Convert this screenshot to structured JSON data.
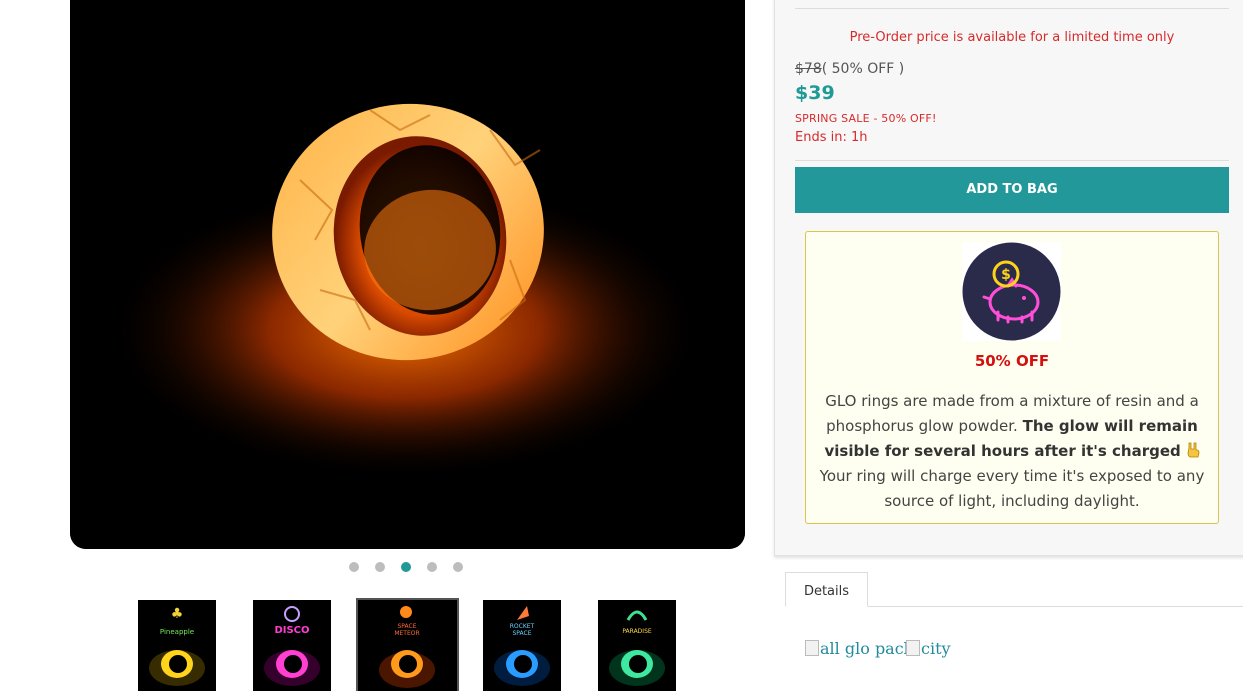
{
  "product": {
    "preorder_note": "Pre-Order price is available for a limited time only",
    "old_price": "$78",
    "discount_pct": "( 50% OFF )",
    "price": "$39",
    "sale_label": "SPRING SALE - 50% OFF!",
    "ends_in": "Ends in: 1h",
    "add_to_bag": "ADD TO BAG"
  },
  "promo": {
    "icon": "piggy-bank-icon",
    "badge": "50% OFF",
    "text_intro": "GLO rings are made from a mixture of resin and a phosphorus glow powder.",
    "text_bold": "The glow will remain visible for several hours after it's charged",
    "text_outro": "Your ring will charge every time it's exposed to any source of light, including daylight."
  },
  "gallery": {
    "active_slide": 3,
    "slide_count": 5,
    "thumbnails": [
      {
        "name": "pineapple",
        "color": "#f2d23a"
      },
      {
        "name": "disco-ball",
        "color": "#e040c8"
      },
      {
        "name": "space-meteor",
        "color": "#ff8a1a"
      },
      {
        "name": "rocket-space",
        "color": "#2a8cff"
      },
      {
        "name": "paradise",
        "color": "#2fe08f"
      }
    ]
  },
  "tabs": [
    {
      "label": "Details"
    }
  ],
  "details_images": [
    {
      "alt": "all glo pack"
    },
    {
      "alt": "city"
    }
  ],
  "colors": {
    "accent": "#23989a",
    "sale_red": "#d62b2b"
  }
}
